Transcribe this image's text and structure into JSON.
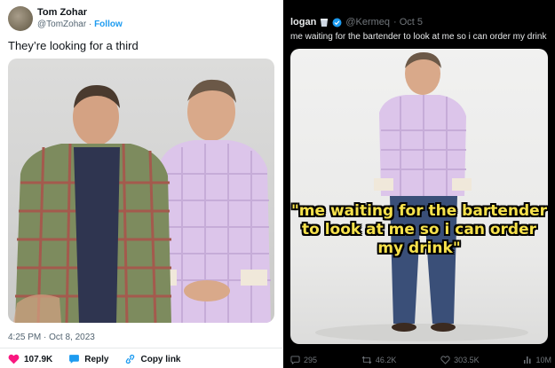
{
  "left_tweet": {
    "author_name": "Tom Zohar",
    "handle": "@TomZohar",
    "separator": "·",
    "follow_label": "Follow",
    "text": "They’re looking for a third",
    "timestamp": "4:25 PM · Oct 8, 2023",
    "actions": {
      "likes": "107.9K",
      "reply_label": "Reply",
      "copy_link_label": "Copy link"
    },
    "colors": {
      "like": "#f91880",
      "link": "#1d9bf0"
    }
  },
  "right_tweet": {
    "author_name": "logan",
    "handle": "@Kermeq",
    "date": "· Oct 5",
    "text": "me waiting for the bartender to look at me so i can order my drink",
    "image_caption": "\"me waiting for the bartender to look at me so i can order my drink\"",
    "stats": {
      "replies": "295",
      "retweets": "46.2K",
      "likes": "303.5K",
      "views": "10M"
    },
    "colors": {
      "caption": "#f6e14b",
      "verified": "#1d9bf0"
    }
  }
}
